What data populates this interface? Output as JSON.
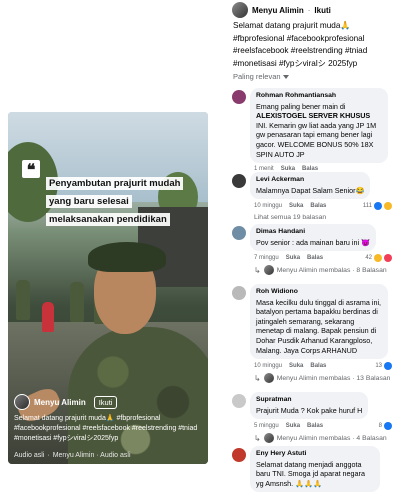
{
  "post": {
    "author": "Menyu Alimin",
    "follow": "Ikuti",
    "dot": "·",
    "text": "Selamat datang prajurit muda🙏 #fbprofesional #facebookprofesional #reelsfacebook #reelstrending #tniad #monetisasi #fypシviralシ 2025fyp"
  },
  "video": {
    "caption": "Penyambutan prajurit mudah yang baru selesai melaksanakan pendidikan",
    "author": "Menyu Alimin",
    "follow": "Ikuti",
    "description": "Selamat datang prajurit muda🙏 #fbprofesional #facebookprofesional #reelsfacebook #reelstrending #tniad #monetisasi #fypシviralシ2025fyp",
    "audio_left": "Audio asli",
    "audio_sep": "·",
    "audio_right": "Menyu Alimin · Audio asli"
  },
  "sort": {
    "label": "Paling relevan"
  },
  "comments": [
    {
      "name": "Rohman Rohmantiansah",
      "text_pre": "Emang paling bener main di ",
      "text_bold": "ALEXISTOGEL SERVER KHUSUS",
      "text_post": " INI. Kemarin gw liat aada yang JP 1M gw penasaran tapi emang bener lagi gacor. WELCOME BONUS 50% 18X SPIN AUTO JP",
      "time": "1 menit",
      "like": "Suka",
      "reply": "Balas",
      "avatar_color": "#8a3b6e"
    },
    {
      "name": "Levi Ackerman",
      "text": "Malamnya Dapat Salam Senior😂",
      "time": "10 minggu",
      "like": "Suka",
      "reply": "Balas",
      "reactions": "111",
      "more": "Lihat semua 19 balasan",
      "avatar_color": "#3a3a3a"
    },
    {
      "name": "Dimas Handani",
      "text": "Pov senior : ada mainan baru ini 😈",
      "time": "7 minggu",
      "like": "Suka",
      "reply": "Balas",
      "reactions": "42",
      "replied_by": "Menyu Alimin membalas · 8 Balasan",
      "avatar_color": "#6f8ea6"
    },
    {
      "name": "Roh Widiono",
      "text": "Masa kecilku dulu tinggal di asrama ini, batalyon pertama bapakku berdinas di jatingaleh semarang, sekarang menetap di malang. Bapak pensiun di Dohar Pusdik Arhanud Karangploso, Malang. Jaya Corps ARHANUD",
      "time": "10 minggu",
      "like": "Suka",
      "reply": "Balas",
      "reactions": "13",
      "replied_by": "Menyu Alimin membalas · 13 Balasan",
      "avatar_color": "#b9b9b9"
    },
    {
      "name": "Supratman",
      "text": "Prajurit Muda ? Kok pake huruf H",
      "time": "5 minggu",
      "like": "Suka",
      "reply": "Balas",
      "reactions": "8",
      "replied_by": "Menyu Alimin membalas · 4 Balasan",
      "avatar_color": "#c9c9c9"
    },
    {
      "name": "Eny Hery Astuti",
      "text": "Selamat datang menjadi anggota baru TNI. Smoga jd aparat negara yg Amsnsh. 🙏🙏🙏",
      "avatar_color": "#c0392b"
    }
  ]
}
